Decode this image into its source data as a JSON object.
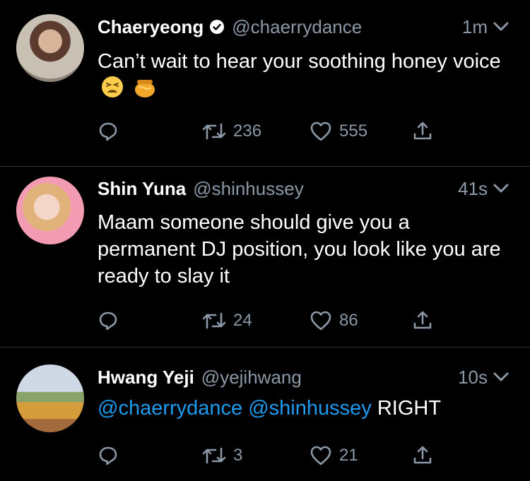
{
  "tweets": [
    {
      "name": "Chaeryeong",
      "verified": true,
      "handle": "@chaerrydance",
      "time": "1m",
      "text": "Can’t wait to hear your soothing honey voice",
      "emojis": [
        "tired-face-emoji",
        "honey-pot-emoji"
      ],
      "retweets": "236",
      "likes": "555"
    },
    {
      "name": "Shin Yuna",
      "verified": false,
      "handle": "@shinhussey",
      "time": "41s",
      "text": "Maam someone should give you a permanent DJ position, you look like you are ready to slay it",
      "retweets": "24",
      "likes": "86"
    },
    {
      "name": "Hwang Yeji",
      "verified": false,
      "handle": "@yejihwang",
      "time": "10s",
      "mentions": [
        "@chaerrydance",
        "@shinhussey"
      ],
      "text": "RIGHT",
      "retweets": "3",
      "likes": "21"
    }
  ],
  "colors": {
    "background": "#000000",
    "text": "#ffffff",
    "secondary": "#8b98a5",
    "link": "#1d9bf0",
    "divider": "#2f3336"
  }
}
